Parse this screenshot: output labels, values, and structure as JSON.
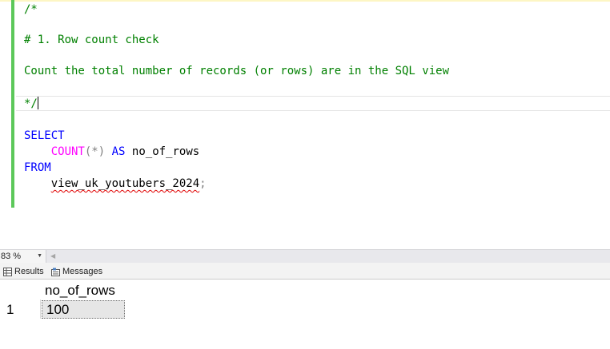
{
  "editor": {
    "comment_open": "/*",
    "heading": "# 1. Row count check",
    "description": "Count the total number of records (or rows) are in the SQL view",
    "comment_close": "*/",
    "sql": {
      "select": "SELECT",
      "count_fn": "COUNT",
      "count_args": "(*)",
      "as_kw": "AS",
      "alias": "no_of_rows",
      "from": "FROM",
      "view_name": "view_uk_youtubers_2024",
      "semicolon": ";"
    }
  },
  "zoom": {
    "level": "83 %"
  },
  "results_tabs": {
    "results_label": "Results",
    "messages_label": "Messages"
  },
  "results_grid": {
    "columns": [
      "no_of_rows"
    ],
    "rows": [
      {
        "row_number": "1",
        "values": [
          "100"
        ]
      }
    ]
  },
  "colors": {
    "comment": "#008000",
    "keyword": "#0000ff",
    "function": "#ff00ff",
    "operator": "#808080",
    "change_margin": "#5cc85a"
  }
}
